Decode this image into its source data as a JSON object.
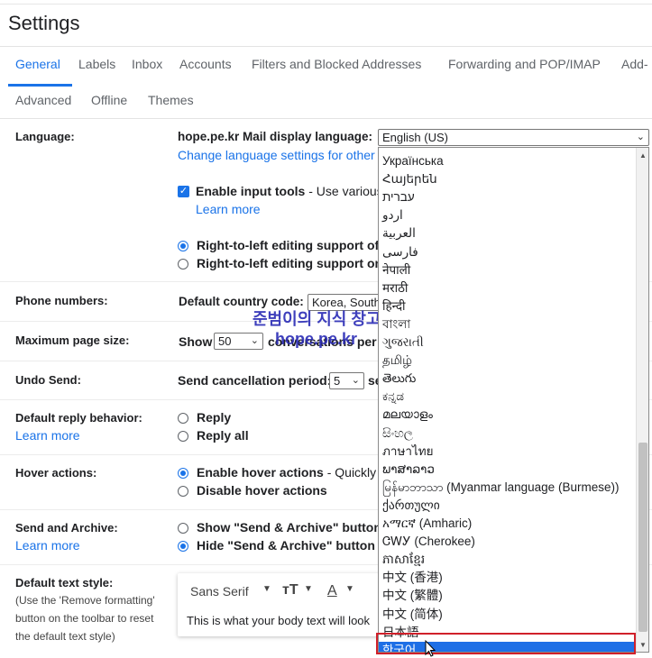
{
  "page": {
    "title": "Settings"
  },
  "tabs": [
    {
      "label": "General",
      "active": true
    },
    {
      "label": "Labels"
    },
    {
      "label": "Inbox"
    },
    {
      "label": "Accounts"
    },
    {
      "label": "Filters and Blocked Addresses"
    },
    {
      "label": "Forwarding and POP/IMAP"
    },
    {
      "label": "Add-"
    },
    {
      "label": "Advanced"
    },
    {
      "label": "Offline"
    },
    {
      "label": "Themes"
    }
  ],
  "language": {
    "title": "Language:",
    "display_label": "hope.pe.kr Mail display language:",
    "selected": "English (US)",
    "change_link": "Change language settings for other",
    "input_tools_label": "Enable input tools",
    "input_tools_desc": " - Use various",
    "learn_more": "Learn more",
    "rtl_on": "Right-to-left editing support of",
    "rtl_off": "Right-to-left editing support on"
  },
  "phone": {
    "title": "Phone numbers:",
    "label": "Default country code:",
    "value": "Korea, South"
  },
  "page_size": {
    "title": "Maximum page size:",
    "show": "Show",
    "value": "50",
    "suffix": "conversations per"
  },
  "undo": {
    "title": "Undo Send:",
    "label": "Send cancellation period:",
    "value": "5",
    "suffix": "se"
  },
  "reply": {
    "title": "Default reply behavior:",
    "learn_more": "Learn more",
    "reply": "Reply",
    "reply_all": "Reply all"
  },
  "hover": {
    "title": "Hover actions:",
    "enable": "Enable hover actions",
    "enable_desc": " - Quickly g",
    "disable": "Disable hover actions"
  },
  "send_archive": {
    "title": "Send and Archive:",
    "learn_more": "Learn more",
    "show": "Show \"Send & Archive\" button i",
    "hide": "Hide \"Send & Archive\" button in"
  },
  "text_style": {
    "title": "Default text style:",
    "note1": "(Use the 'Remove formatting'",
    "note2": "button on the toolbar to reset",
    "note3": "the default text style)",
    "font": "Sans Serif",
    "preview": "This is what your body text will look"
  },
  "watermark": {
    "line1": "준범이의 지식 창고",
    "line2": "hope.pe.kr"
  },
  "dropdown": {
    "items": [
      "Українська",
      "Հայերեն",
      "עברית",
      "اردو",
      "العربية",
      "فارسی",
      "नेपाली",
      "मराठी",
      "हिन्दी",
      "বাংলা",
      "ગુજરાતી",
      "தமிழ்",
      "తెలుగు",
      "ಕನ್ನಡ",
      "മലയാളം",
      "සිංහල",
      "ภาษาไทย",
      "ພາສາລາວ",
      "မြန်မာဘာသာ (Myanmar language (Burmese))",
      "ქართული",
      "አማርኛ (Amharic)",
      "ᏣᎳᎩ (Cherokee)",
      "ភាសាខ្មែរ",
      "中文 (香港)",
      "中文 (繁體)",
      "中文 (简体)",
      "日本語",
      "한국어"
    ]
  },
  "colors": {
    "accent": "#1a73e8",
    "selected": "#1e6fe6",
    "highlight": "#d0202a"
  }
}
